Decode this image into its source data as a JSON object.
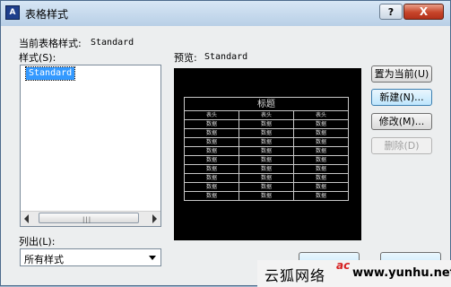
{
  "window": {
    "title": "表格样式",
    "help_label": "?",
    "close_label": "X"
  },
  "current_style": {
    "label": "当前表格样式:",
    "value": "Standard"
  },
  "styles": {
    "label": "样式(S):",
    "items": [
      "Standard"
    ],
    "selected": "Standard"
  },
  "list_filter": {
    "label": "列出(L):",
    "value": "所有样式"
  },
  "preview": {
    "label": "预览:",
    "style_name": "Standard",
    "table": {
      "title": "标题",
      "headers": [
        "表头",
        "表头",
        "表头"
      ],
      "rows": [
        [
          "数据",
          "数据",
          "数据"
        ],
        [
          "数据",
          "数据",
          "数据"
        ],
        [
          "数据",
          "数据",
          "数据"
        ],
        [
          "数据",
          "数据",
          "数据"
        ],
        [
          "数据",
          "数据",
          "数据"
        ],
        [
          "数据",
          "数据",
          "数据"
        ],
        [
          "数据",
          "数据",
          "数据"
        ],
        [
          "数据",
          "数据",
          "数据"
        ],
        [
          "数据",
          "数据",
          "数据"
        ]
      ]
    }
  },
  "buttons": {
    "set_current": "置为当前(U)",
    "new": "新建(N)...",
    "modify": "修改(M)...",
    "delete": "删除(D)"
  },
  "watermark": {
    "text": "云狐网络",
    "logo": "ac",
    "url": "www.yunhu.net"
  }
}
